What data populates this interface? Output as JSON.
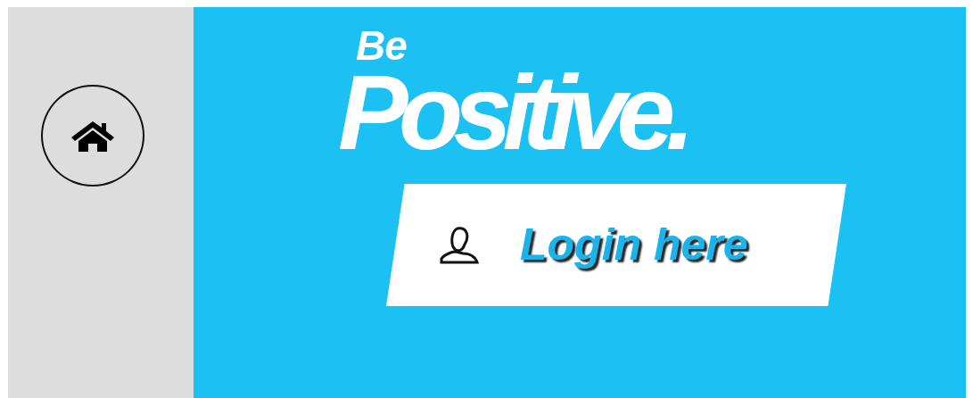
{
  "logo": {
    "small": "Be",
    "large": "Positive."
  },
  "login_button": {
    "label": "Login here"
  }
}
